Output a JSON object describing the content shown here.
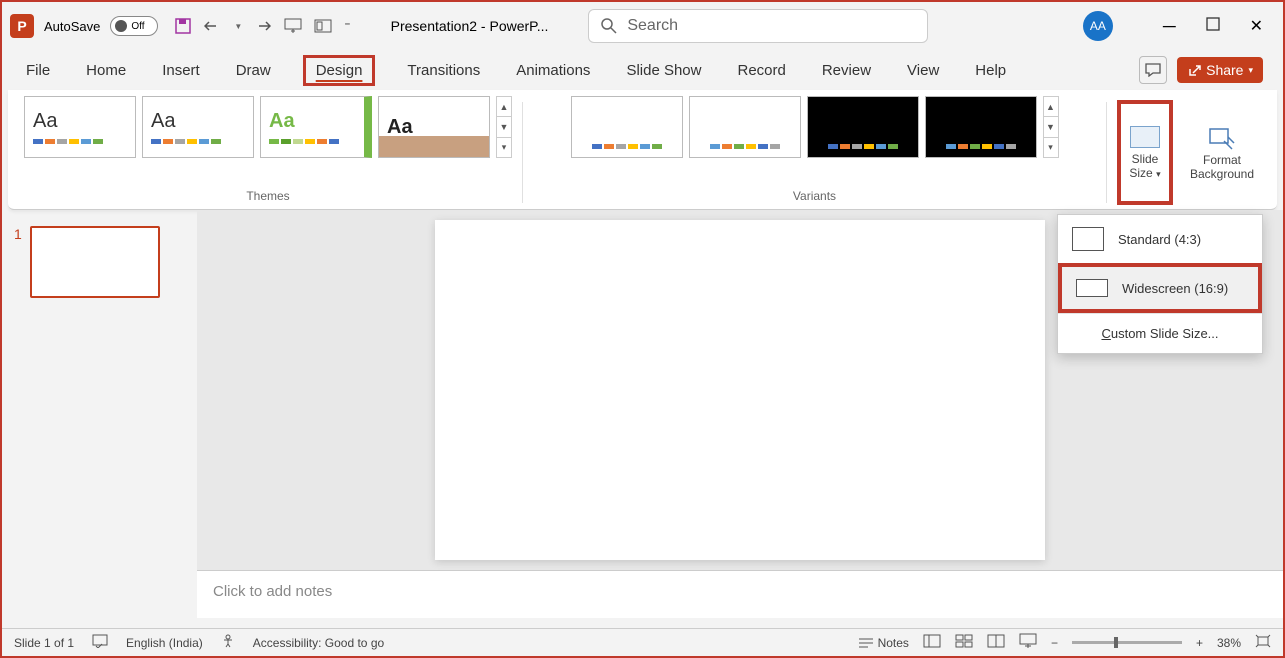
{
  "titlebar": {
    "autosave_label": "AutoSave",
    "autosave_state": "Off",
    "title": "Presentation2 - PowerP...",
    "search_placeholder": "Search",
    "avatar_initials": "AA"
  },
  "tabs": {
    "file": "File",
    "home": "Home",
    "insert": "Insert",
    "draw": "Draw",
    "design": "Design",
    "transitions": "Transitions",
    "animations": "Animations",
    "slideshow": "Slide Show",
    "record": "Record",
    "review": "Review",
    "view": "View",
    "help": "Help",
    "share": "Share"
  },
  "ribbon": {
    "themes_label": "Themes",
    "variants_label": "Variants",
    "slide_size_label_1": "Slide",
    "slide_size_label_2": "Size",
    "format_bg_label_1": "Format",
    "format_bg_label_2": "Background",
    "theme_aa": "Aa"
  },
  "slide_size_menu": {
    "standard": "Standard (4:3)",
    "widescreen": "Widescreen (16:9)",
    "custom": "Custom Slide Size..."
  },
  "slide_panel": {
    "slide_number": "1"
  },
  "notes": {
    "placeholder": "Click to add notes"
  },
  "statusbar": {
    "slide_info": "Slide 1 of 1",
    "language": "English (India)",
    "accessibility": "Accessibility: Good to go",
    "notes_btn": "Notes",
    "zoom_value": "38%"
  }
}
